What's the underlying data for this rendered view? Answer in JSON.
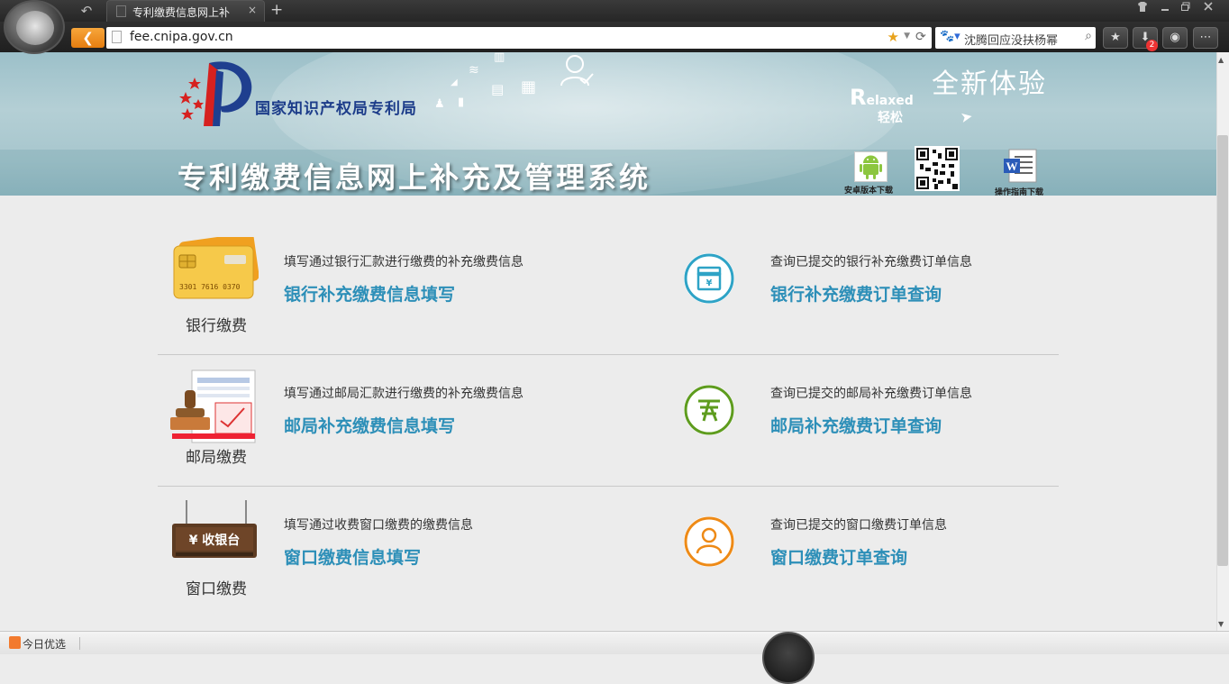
{
  "browser": {
    "tab_title": "专利缴费信息网上补",
    "url": "fee.cnipa.gov.cn",
    "search_query": "沈腾回应没扶杨幂",
    "download_badge": "2",
    "back_glyph": "❮",
    "undo_glyph": "↶",
    "new_tab_glyph": "+",
    "tab_close_glyph": "×"
  },
  "banner": {
    "org_name": "国家知识产权局专利局",
    "system_title": "专利缴费信息网上补充及管理系统",
    "new_experience": "全新体验",
    "relaxed_first": "R",
    "relaxed_rest": "elaxed",
    "relaxed_cn": "轻松",
    "android_label": "安卓版本下载",
    "guide_label": "操作指南下载"
  },
  "sections": [
    {
      "caption": "银行缴费",
      "fill_desc": "填写通过银行汇款进行缴费的补充缴费信息",
      "fill_link": "银行补充缴费信息填写",
      "query_desc": "查询已提交的银行补充缴费订单信息",
      "query_link": "银行补充缴费订单查询",
      "color": "#2ea3c6",
      "card_number": "3301 7616 0370"
    },
    {
      "caption": "邮局缴费",
      "fill_desc": "填写通过邮局汇款进行缴费的补充缴费信息",
      "fill_link": "邮局补充缴费信息填写",
      "query_desc": "查询已提交的邮局补充缴费订单信息",
      "query_link": "邮局补充缴费订单查询",
      "color": "#5e9c1e"
    },
    {
      "caption": "窗口缴费",
      "fill_desc": "填写通过收费窗口缴费的缴费信息",
      "fill_link": "窗口缴费信息填写",
      "query_desc": "查询已提交的窗口缴费订单信息",
      "query_link": "窗口缴费订单查询",
      "color": "#ee8a16",
      "sign_text": "¥ 收银台"
    }
  ],
  "status_bar": {
    "today_label": "今日优选"
  }
}
